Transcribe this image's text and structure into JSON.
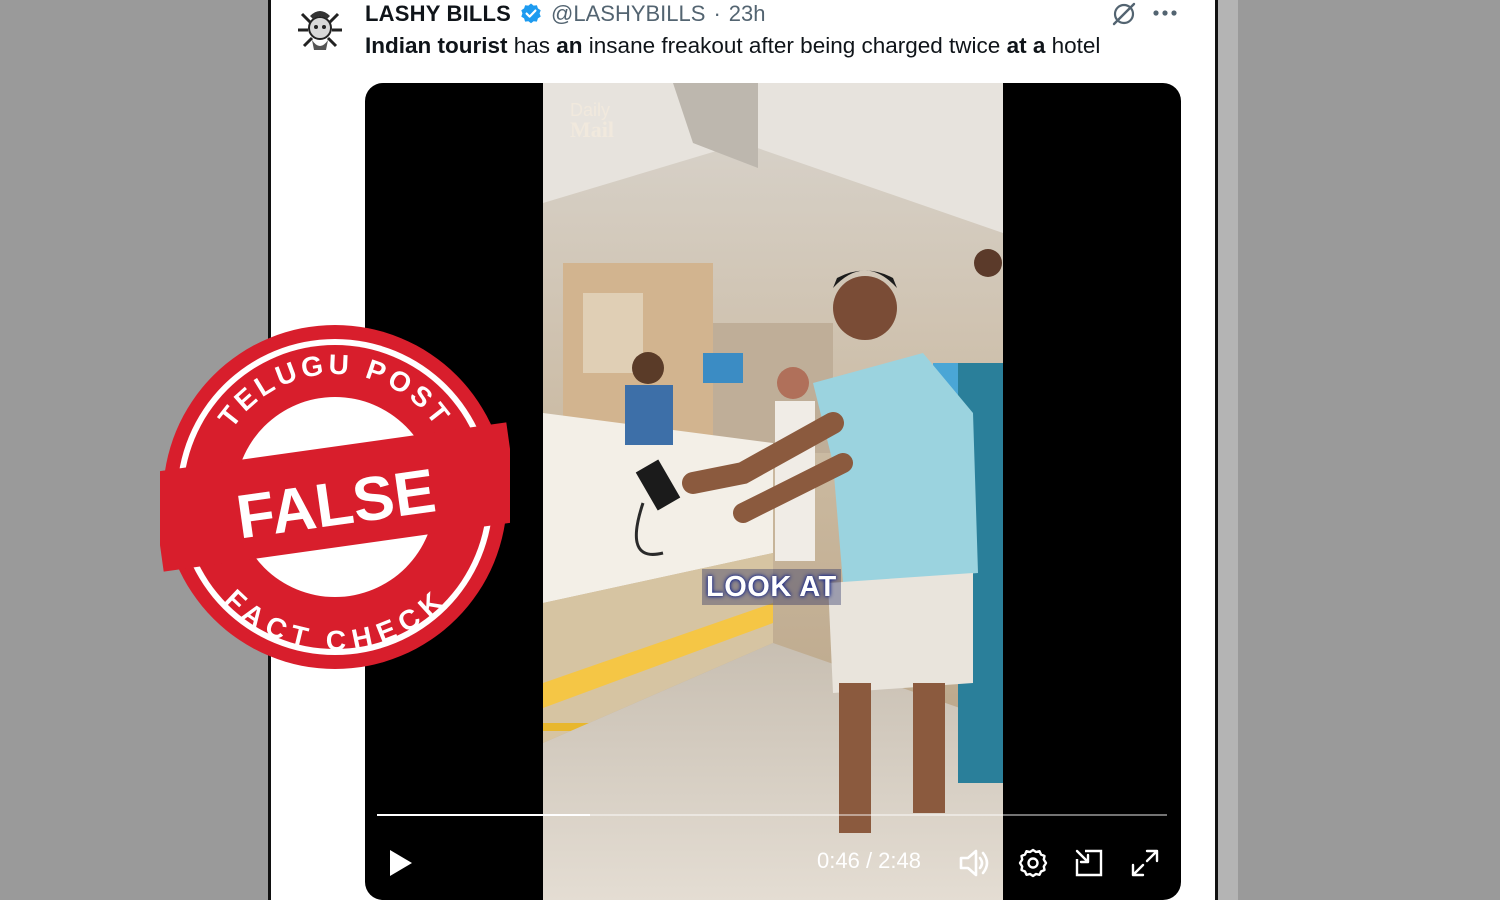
{
  "tweet": {
    "display_name": "LASHY BILLS",
    "handle": "@LASHYBILLS",
    "separator": "·",
    "time": "23h",
    "text_parts": [
      {
        "text": "Indian tourist",
        "bold": true
      },
      {
        "text": " has ",
        "bold": false
      },
      {
        "text": "an",
        "bold": true
      },
      {
        "text": " insane freakout after being charged twice ",
        "bold": false
      },
      {
        "text": "at a",
        "bold": true
      },
      {
        "text": " hotel",
        "bold": false
      }
    ],
    "icons": [
      "avatar",
      "verified-badge-icon",
      "grok-icon",
      "more-icon"
    ]
  },
  "video": {
    "caption": "LOOK AT",
    "watermark_line1": "Daily",
    "watermark_line2": "Mail",
    "current_time": "0:46",
    "duration": "2:48",
    "time_separator": " / ",
    "progress_fraction": 0.27,
    "controls": [
      "play-icon",
      "volume-icon",
      "settings-icon",
      "pip-icon",
      "fullscreen-icon"
    ]
  },
  "stamp": {
    "top_text": "TELUGU POST",
    "center_text": "FALSE",
    "bottom_text": "FACT CHECK",
    "color": "#d81e2c"
  },
  "colors": {
    "verified_blue": "#1d9bf0",
    "text_primary": "#0f1419",
    "text_secondary": "#536471"
  }
}
